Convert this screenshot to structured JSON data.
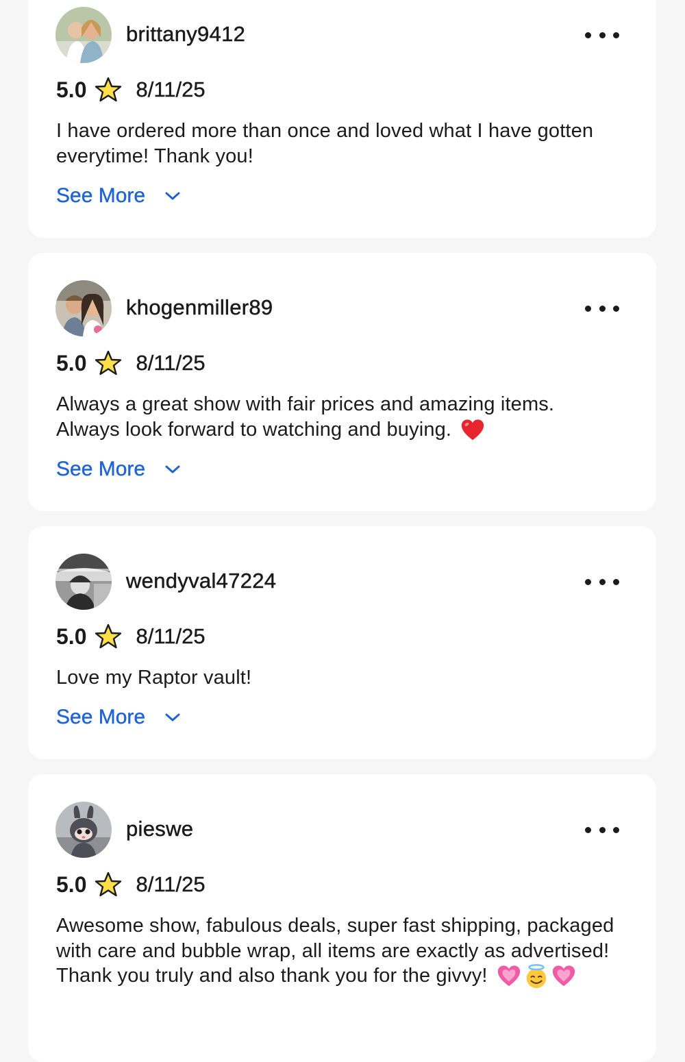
{
  "reviews": [
    {
      "username": "brittany9412",
      "rating": "5.0",
      "date": "8/11/25",
      "text": "I have ordered more than once and loved what I have gotten everytime! Thank you!",
      "emoji_suffix": [],
      "see_more_label": "See More"
    },
    {
      "username": "khogenmiller89",
      "rating": "5.0",
      "date": "8/11/25",
      "text": "Always a great show with fair prices and amazing items. Always look forward to watching and buying.",
      "emoji_suffix": [
        "red-heart"
      ],
      "see_more_label": "See More"
    },
    {
      "username": "wendyval47224",
      "rating": "5.0",
      "date": "8/11/25",
      "text": "Love my Raptor vault!",
      "emoji_suffix": [],
      "see_more_label": "See More"
    },
    {
      "username": "pieswe",
      "rating": "5.0",
      "date": "8/11/25",
      "text": "Awesome show, fabulous deals, super fast shipping, packaged with care and bubble wrap, all items are exactly as advertised! Thank you truly and also thank you for the givvy!",
      "emoji_suffix": [
        "pink-heart",
        "halo-smile",
        "pink-heart"
      ],
      "see_more_label": ""
    }
  ],
  "icons": {
    "star": "star-icon",
    "more": "more-options-icon",
    "chevron": "chevron-down-icon"
  },
  "colors": {
    "background": "#f6f6f7",
    "card": "#ffffff",
    "link": "#1f64d4",
    "star_fill": "#fde047",
    "star_stroke": "#1b1b1c"
  }
}
